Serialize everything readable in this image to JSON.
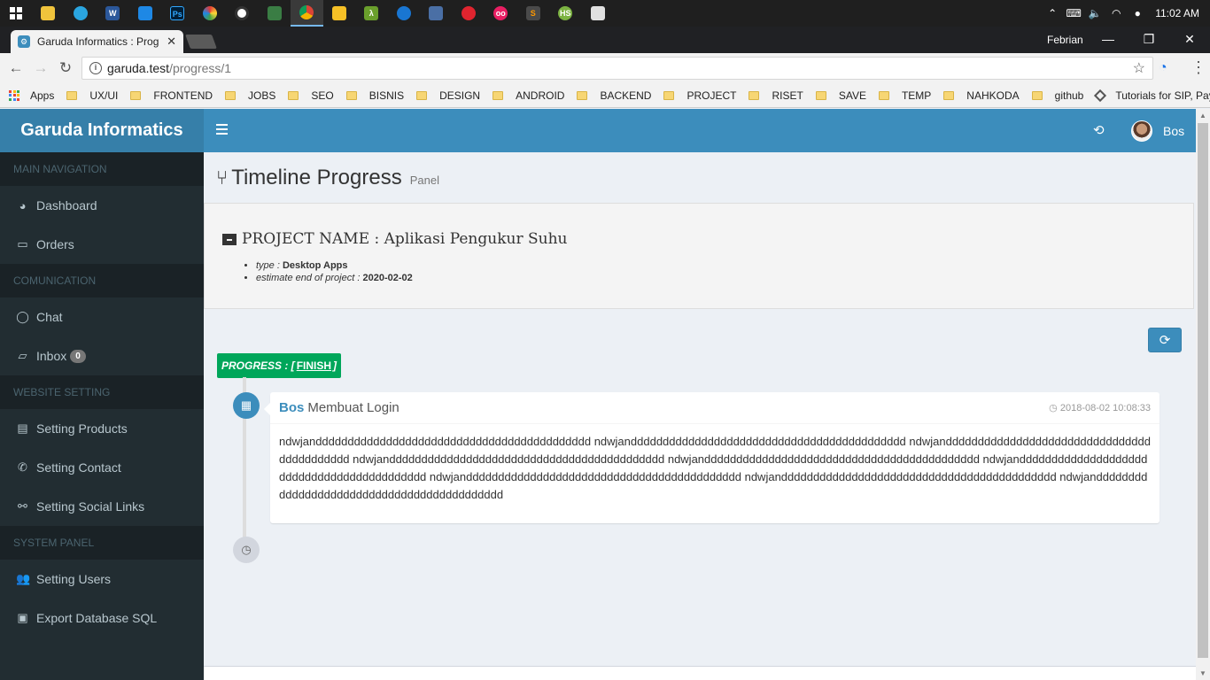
{
  "taskbar": {
    "clock": "11:02 AM"
  },
  "browser": {
    "tab_title": "Garuda Informatics : Prog",
    "profile_name": "Febrian",
    "url_host": "garuda.test",
    "url_path": "/progress/1",
    "bookmarks": [
      "Apps",
      "UX/UI",
      "FRONTEND",
      "JOBS",
      "SEO",
      "BISNIS",
      "DESIGN",
      "ANDROID",
      "BACKEND",
      "PROJECT",
      "RISET",
      "SAVE",
      "TEMP",
      "NAHKODA",
      "github",
      "Tutorials for SIP, Pay"
    ]
  },
  "sidebar": {
    "brand": "Garuda Informatics",
    "sections": [
      {
        "header": "MAIN NAVIGATION",
        "items": [
          {
            "label": "Dashboard",
            "icon": "dashboard-icon"
          },
          {
            "label": "Orders",
            "icon": "credit-card-icon"
          }
        ]
      },
      {
        "header": "COMUNICATION",
        "items": [
          {
            "label": "Chat",
            "icon": "chat-icon"
          },
          {
            "label": "Inbox",
            "icon": "inbox-icon",
            "badge": "0"
          }
        ]
      },
      {
        "header": "WEBSITE SETTING",
        "items": [
          {
            "label": "Setting Products",
            "icon": "archive-icon"
          },
          {
            "label": "Setting Contact",
            "icon": "phone-icon"
          },
          {
            "label": "Setting Social Links",
            "icon": "unlink-icon"
          }
        ]
      },
      {
        "header": "SYSTEM PANEL",
        "items": [
          {
            "label": "Setting Users",
            "icon": "users-icon"
          },
          {
            "label": "Export Database SQL",
            "icon": "save-icon"
          }
        ]
      }
    ]
  },
  "header": {
    "user_name": "Bos"
  },
  "page": {
    "title": "Timeline Progress",
    "subtitle": "Panel"
  },
  "project": {
    "name": "PROJECT NAME : Aplikasi Pengukur Suhu",
    "type_label": "type :",
    "type_value": "Desktop Apps",
    "estimate_label": "estimate end of project :",
    "estimate_value": "2020-02-02"
  },
  "progress": {
    "prefix": "PROGRESS : [",
    "status": "FINISH",
    "suffix": "]"
  },
  "timeline": {
    "who": "Bos",
    "action": "Membuat Login",
    "time": "2018-08-02 10:08:33",
    "body": "ndwjanddddddddddddddddddddddddddddddddddddddddddd ndwjanddddddddddddddddddddddddddddddddddddddddddd ndwjanddddddddddddddddddddddddddddddddddddddddddd ndwjanddddddddddddddddddddddddddddddddddddddddddd ndwjanddddddddddddddddddddddddddddddddddddddddddd ndwjanddddddddddddddddddddddddddddddddddddddddddd ndwjanddddddddddddddddddddddddddddddddddddddddddd ndwjanddddddddddddddddddddddddddddddddddddddddddd ndwjanddddddddddddddddddddddddddddddddddddddddddd"
  },
  "colors": {
    "primary": "#3c8dbc",
    "sidebar": "#222d32",
    "success": "#00a65a"
  }
}
